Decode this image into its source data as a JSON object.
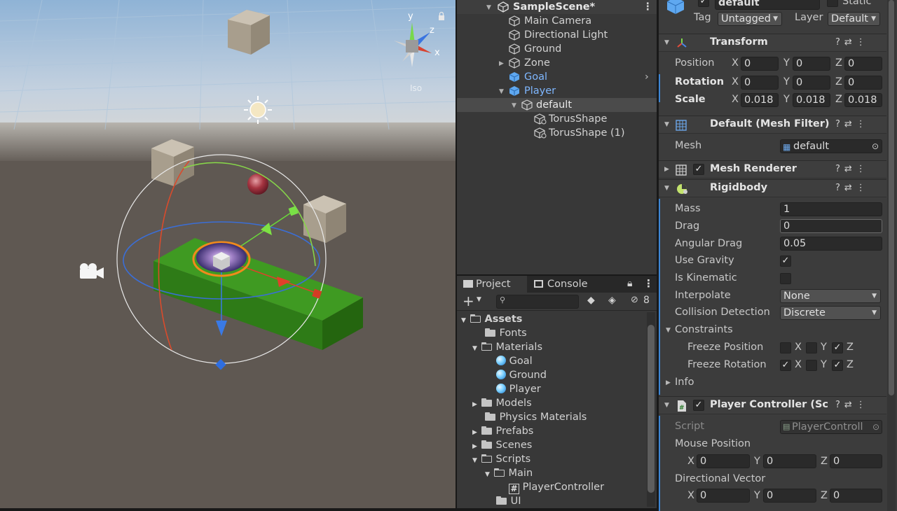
{
  "hierarchy": {
    "scene_name": "SampleScene*",
    "items": [
      {
        "label": "Main Camera"
      },
      {
        "label": "Directional Light"
      },
      {
        "label": "Ground"
      },
      {
        "label": "Zone"
      },
      {
        "label": "Goal"
      },
      {
        "label": "Player"
      },
      {
        "label": "default"
      },
      {
        "label": "TorusShape"
      },
      {
        "label": "TorusShape (1)"
      }
    ]
  },
  "project": {
    "tabs": [
      "Project",
      "Console"
    ],
    "hidden_count": "8",
    "tree": [
      {
        "label": "Assets"
      },
      {
        "label": "Fonts"
      },
      {
        "label": "Materials"
      },
      {
        "label": "Goal"
      },
      {
        "label": "Ground"
      },
      {
        "label": "Player"
      },
      {
        "label": "Models"
      },
      {
        "label": "Physics Materials"
      },
      {
        "label": "Prefabs"
      },
      {
        "label": "Scenes"
      },
      {
        "label": "Scripts"
      },
      {
        "label": "Main"
      },
      {
        "label": "PlayerController"
      },
      {
        "label": "UI"
      }
    ]
  },
  "inspector": {
    "object_name": "default",
    "static_label": "Static",
    "tag_label": "Tag",
    "tag_value": "Untagged",
    "layer_label": "Layer",
    "layer_value": "Default",
    "transform": {
      "title": "Transform",
      "position_label": "Position",
      "rotation_label": "Rotation",
      "scale_label": "Scale",
      "axis_x": "X",
      "axis_y": "Y",
      "axis_z": "Z",
      "position": [
        "0",
        "0",
        "0"
      ],
      "rotation": [
        "0",
        "0",
        "0"
      ],
      "scale": [
        "0.018",
        "0.018",
        "0.018"
      ]
    },
    "mesh_filter": {
      "title": "Default (Mesh Filter)",
      "mesh_label": "Mesh",
      "mesh_value": "default"
    },
    "mesh_renderer": {
      "title": "Mesh Renderer"
    },
    "rigidbody": {
      "title": "Rigidbody",
      "mass_label": "Mass",
      "mass": "1",
      "drag_label": "Drag",
      "drag": "0",
      "angular_drag_label": "Angular Drag",
      "angular_drag": "0.05",
      "use_gravity_label": "Use Gravity",
      "is_kinematic_label": "Is Kinematic",
      "interpolate_label": "Interpolate",
      "interpolate": "None",
      "collision_label": "Collision Detection",
      "collision": "Discrete",
      "constraints_label": "Constraints",
      "freeze_position_label": "Freeze Position",
      "freeze_rotation_label": "Freeze Rotation",
      "info_label": "Info"
    },
    "player_controller": {
      "title": "Player Controller (Scri",
      "script_label": "Script",
      "script_value": "PlayerControll",
      "mouse_position_label": "Mouse Position",
      "mouse_position": [
        "0",
        "0",
        "0"
      ],
      "directional_vector_label": "Directional Vector",
      "directional_vector": [
        "0",
        "0",
        "0"
      ]
    }
  },
  "scene": {
    "gizmo_x": "x",
    "gizmo_y": "y",
    "gizmo_z": "z",
    "gizmo_mode": "Iso"
  },
  "colors": {
    "selection_blue": "#7fb7ff",
    "ground_green": "#3f9a22",
    "accent_orange": "#f08a1c"
  }
}
